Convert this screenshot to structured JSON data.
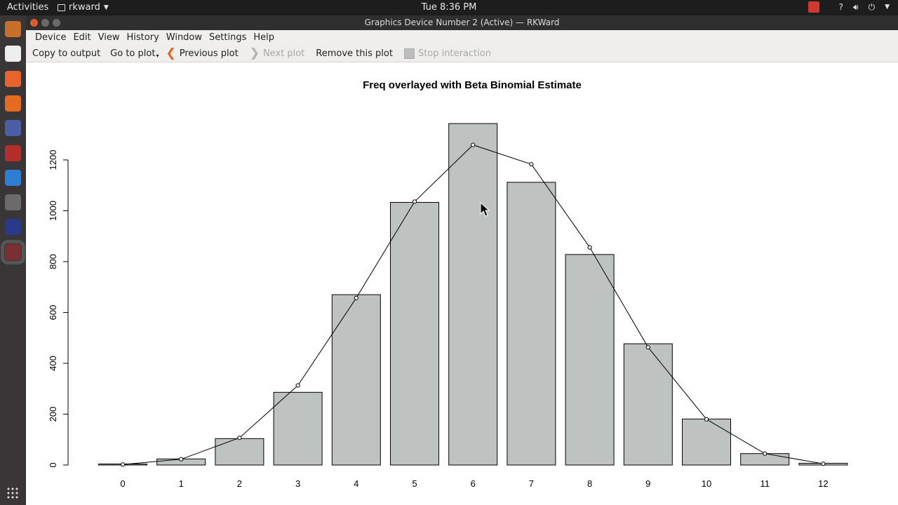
{
  "topbar": {
    "activities": "Activities",
    "app_name": "rkward",
    "clock": "Tue  8:36 PM"
  },
  "dock": {
    "items": [
      {
        "name": "files-icon",
        "color": "#c8702a"
      },
      {
        "name": "document-icon",
        "color": "#eeeeee"
      },
      {
        "name": "software-store-icon",
        "color": "#e8642c"
      },
      {
        "name": "firefox-icon",
        "color": "#e66b1f"
      },
      {
        "name": "app-icon",
        "color": "#4a5fa8"
      },
      {
        "name": "app-icon",
        "color": "#b52f2a"
      },
      {
        "name": "app-icon",
        "color": "#2d7fd3"
      },
      {
        "name": "calculator-icon",
        "color": "#6b6b6b"
      },
      {
        "name": "tex-icon",
        "color": "#2a3a8a"
      },
      {
        "name": "rkward-icon",
        "color": "#7a3030"
      }
    ]
  },
  "window": {
    "title": "Graphics Device Number 2 (Active) — RKWard"
  },
  "menubar": {
    "items": [
      "Device",
      "Edit",
      "View",
      "History",
      "Window",
      "Settings",
      "Help"
    ]
  },
  "toolbar": {
    "copy_to_output": "Copy to output",
    "go_to_plot": "Go to plot",
    "previous_plot": "Previous plot",
    "next_plot": "Next plot",
    "remove_plot": "Remove this plot",
    "stop_interaction": "Stop interaction"
  },
  "chart_data": {
    "type": "bar",
    "title": "Freq overlayed with Beta Binomial Estimate",
    "categories": [
      "0",
      "1",
      "2",
      "3",
      "4",
      "5",
      "6",
      "7",
      "8",
      "9",
      "10",
      "11",
      "12"
    ],
    "values": [
      4,
      24,
      104,
      286,
      670,
      1033,
      1343,
      1112,
      828,
      477,
      181,
      45,
      7
    ],
    "overlay": {
      "type": "line",
      "markers": "open-circle",
      "values": [
        2,
        23,
        107,
        313,
        657,
        1036,
        1259,
        1183,
        856,
        463,
        180,
        45,
        5
      ]
    },
    "yticks": [
      0,
      200,
      400,
      600,
      800,
      1000,
      1200
    ],
    "ylim": [
      0,
      1350
    ],
    "grid": false,
    "bar_color": "#bec3c2"
  }
}
